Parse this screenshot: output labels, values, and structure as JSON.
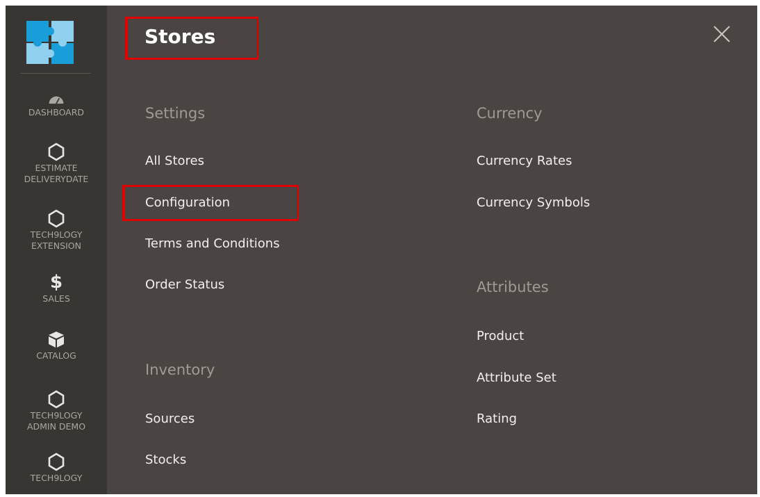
{
  "sidebar": {
    "items": [
      {
        "label": "DASHBOARD",
        "icon": "gauge-icon"
      },
      {
        "label": "ESTIMATE DELIVERYDATE",
        "line1": "ESTIMATE",
        "line2": "DELIVERYDATE",
        "icon": "hexagon-icon"
      },
      {
        "label": "TECH9LOGY EXTENSION",
        "line1": "TECH9LOGY",
        "line2": "EXTENSION",
        "icon": "hexagon-icon"
      },
      {
        "label": "SALES",
        "icon": "dollar-icon",
        "glyph": "$"
      },
      {
        "label": "CATALOG",
        "icon": "box-icon"
      },
      {
        "label": "TECH9LOGY ADMIN DEMO",
        "line1": "TECH9LOGY",
        "line2": "ADMIN DEMO",
        "icon": "hexagon-icon"
      },
      {
        "label": "TECH9LOGY",
        "icon": "hexagon-icon"
      }
    ]
  },
  "panel": {
    "title": "Stores",
    "sections": {
      "settings": {
        "heading": "Settings",
        "links": [
          "All Stores",
          "Configuration",
          "Terms and Conditions",
          "Order Status"
        ]
      },
      "inventory": {
        "heading": "Inventory",
        "links": [
          "Sources",
          "Stocks"
        ]
      },
      "currency": {
        "heading": "Currency",
        "links": [
          "Currency Rates",
          "Currency Symbols"
        ]
      },
      "attributes": {
        "heading": "Attributes",
        "links": [
          "Product",
          "Attribute Set",
          "Rating"
        ]
      }
    }
  },
  "colors": {
    "panel_bg": "#4a4542",
    "sidebar_bg": "#383633",
    "highlight": "#e00000",
    "logo_blue": "#1aa3e0"
  }
}
